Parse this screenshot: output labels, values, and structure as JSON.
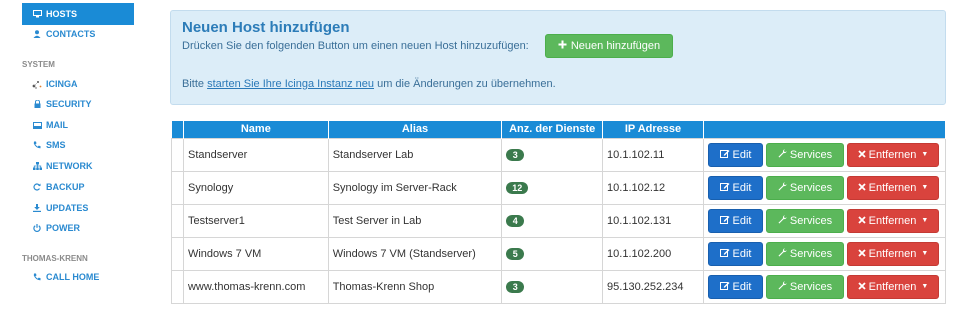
{
  "sidebar": {
    "items_top": [
      {
        "label": "HOSTS",
        "icon": "monitor-icon",
        "active": true
      },
      {
        "label": "CONTACTS",
        "icon": "user-icon",
        "active": false
      }
    ],
    "section_system": "SYSTEM",
    "items_system": [
      {
        "label": "ICINGA",
        "icon": "icinga-icon"
      },
      {
        "label": "SECURITY",
        "icon": "lock-icon"
      },
      {
        "label": "MAIL",
        "icon": "inbox-icon"
      },
      {
        "label": "SMS",
        "icon": "phone-icon"
      },
      {
        "label": "NETWORK",
        "icon": "network-icon"
      },
      {
        "label": "BACKUP",
        "icon": "refresh-icon"
      },
      {
        "label": "UPDATES",
        "icon": "download-icon"
      },
      {
        "label": "POWER",
        "icon": "power-icon"
      }
    ],
    "section_tk": "THOMAS-KRENN",
    "items_tk": [
      {
        "label": "CALL HOME",
        "icon": "phone-icon"
      }
    ]
  },
  "panel": {
    "title": "Neuen Host hinzufügen",
    "line1": "Drücken Sie den folgenden Button um einen neuen Host hinzuzufügen:",
    "add_button": "Neuen hinzufügen",
    "line2_prefix": "Bitte ",
    "line2_link": "starten Sie Ihre Icinga Instanz neu",
    "line2_suffix": " um die Änderungen zu übernehmen."
  },
  "table": {
    "headers": [
      "Name",
      "Alias",
      "Anz. der Dienste",
      "IP Adresse"
    ],
    "rows": [
      {
        "name": "Standserver",
        "alias": "Standserver Lab",
        "services": "3",
        "ip": "10.1.102.11"
      },
      {
        "name": "Synology",
        "alias": "Synology im Server-Rack",
        "services": "12",
        "ip": "10.1.102.12"
      },
      {
        "name": "Testserver1",
        "alias": "Test Server in Lab",
        "services": "4",
        "ip": "10.1.102.131"
      },
      {
        "name": "Windows 7 VM",
        "alias": "Windows 7 VM (Standserver)",
        "services": "5",
        "ip": "10.1.102.200"
      },
      {
        "name": "www.thomas-krenn.com",
        "alias": "Thomas-Krenn Shop",
        "services": "3",
        "ip": "95.130.252.234"
      }
    ],
    "btn_edit": "Edit",
    "btn_services": "Services",
    "btn_remove": "Entfernen"
  },
  "colors": {
    "accent": "#1a8bd6",
    "success": "#5cb85c",
    "danger": "#d9433d",
    "panel_bg": "#dcedf8"
  }
}
